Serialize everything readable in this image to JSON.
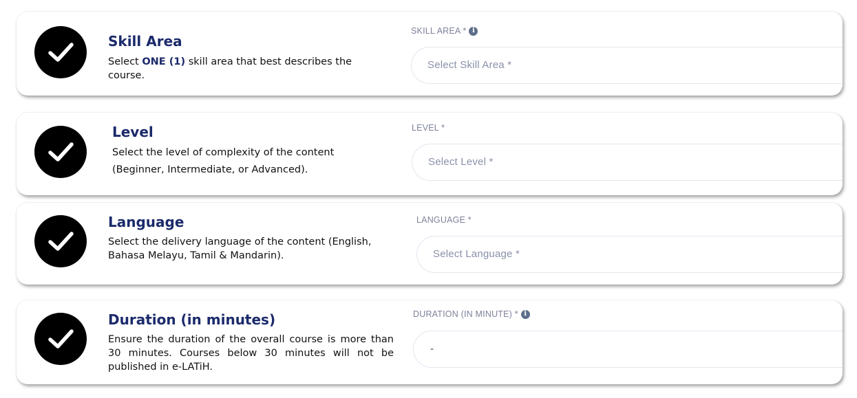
{
  "sections": [
    {
      "title": "Skill Area",
      "description_before": "Select ",
      "description_strong": "ONE (1)",
      "description_after": " skill area that best describes the course.",
      "field_label": "SKILL AREA *",
      "field_placeholder": "Select Skill Area *",
      "has_info_icon": true,
      "icon": "checkmark-icon"
    },
    {
      "title": "Level",
      "description": "Select the level of complexity of the content (Beginner, Intermediate, or Advanced).",
      "field_label": "LEVEL *",
      "field_placeholder": "Select Level *",
      "has_info_icon": false,
      "icon": "checkmark-icon"
    },
    {
      "title": "Language",
      "description": "Select the delivery language of the content (English, Bahasa Melayu, Tamil & Mandarin).",
      "field_label": "LANGUAGE *",
      "field_placeholder": "Select Language *",
      "has_info_icon": false,
      "icon": "checkmark-icon"
    },
    {
      "title": "Duration (in minutes)",
      "description": "Ensure the duration of the overall course is more than 30 minutes. Courses below 30 minutes will not be published in e-LATiH.",
      "field_label": "DURATION (IN MINUTE) *",
      "field_value": "-",
      "has_info_icon": true,
      "icon": "checkmark-icon"
    }
  ],
  "colors": {
    "title": "#1b2a6b",
    "label": "#7e8299",
    "placeholder": "#8a91a8",
    "check_bg": "#000000",
    "info_icon": "#5d6f8a"
  },
  "info_glyph": "i"
}
